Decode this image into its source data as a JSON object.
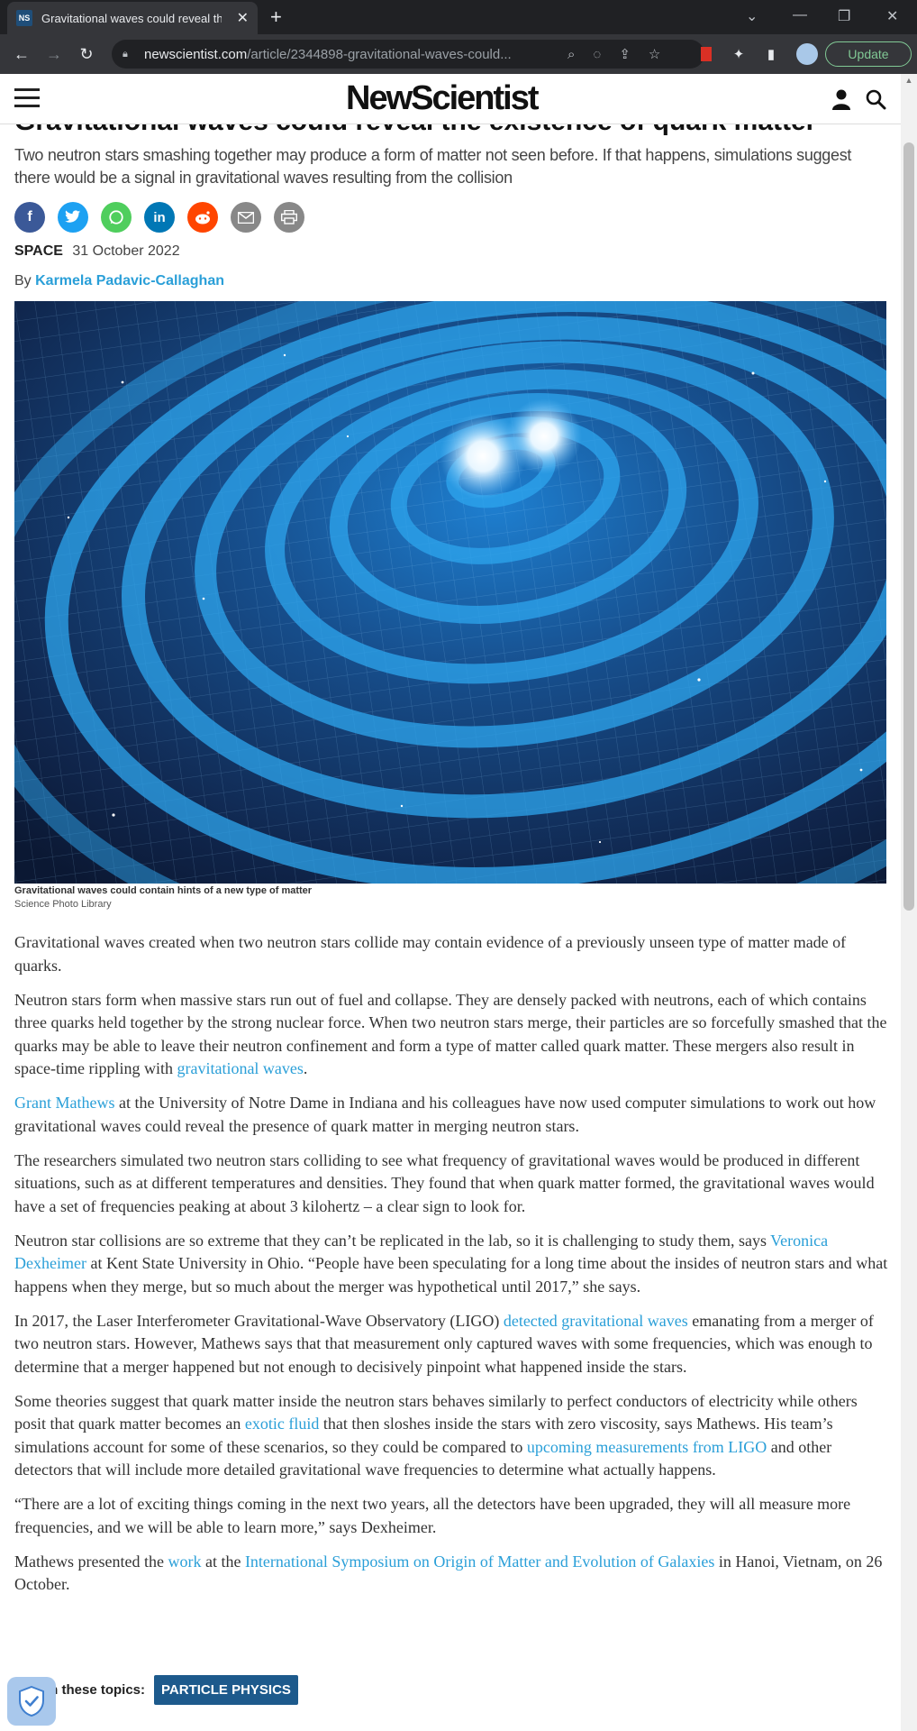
{
  "browser": {
    "tab_title": "Gravitational waves could reveal the existence of quark matter",
    "favicon_text": "NS",
    "url_domain": "newscientist.com",
    "url_path": "/article/2344898-gravitational-waves-could...",
    "update_label": "Update"
  },
  "site": {
    "logo": "NewScientist"
  },
  "article": {
    "title": "Gravitational waves could reveal the existence of quark matter",
    "standfirst": "Two neutron stars smashing together may produce a form of matter not seen before. If that happens, simulations suggest there would be a signal in gravitational waves resulting from the collision",
    "share_icons": [
      "facebook-icon",
      "twitter-icon",
      "whatsapp-icon",
      "linkedin-icon",
      "reddit-icon",
      "email-icon",
      "print-icon"
    ],
    "section": "SPACE",
    "date": "31 October 2022",
    "byline_prefix": "By",
    "author": "Karmela Padavic-Callaghan",
    "image_caption": "Gravitational waves could contain hints of a new type of matter",
    "image_credit": "Science Photo Library",
    "paragraphs": [
      {
        "t1": "Gravitational waves created when two neutron stars collide may contain evidence of a previously unseen type of matter made of quarks."
      },
      {
        "t1": "Neutron stars form when massive stars run out of fuel and collapse. They are densely packed with neutrons, each of which contains three quarks held together by the strong nuclear force. When two neutron stars merge, their particles are so forcefully smashed that the quarks may be able to leave their neutron confinement and form a type of matter called quark matter. These mergers also result in space-time rippling with ",
        "l1": "gravitational waves",
        "t2": "."
      },
      {
        "l1": "Grant Mathews",
        "t1": " at the University of Notre Dame in Indiana and his colleagues have now used computer simulations to work out how gravitational waves could reveal the presence of quark matter in merging neutron stars."
      },
      {
        "t1": "The researchers simulated two neutron stars colliding to see what frequency of gravitational waves would be produced in different situations, such as at different temperatures and densities. They found that when quark matter formed, the gravitational waves would have a set of frequencies peaking at about 3 kilohertz – a clear sign to look for."
      },
      {
        "t1": "Neutron star collisions are so extreme that they can’t be replicated in the lab, so it is challenging to study them, says ",
        "l1": "Veronica Dexheimer",
        "t2": " at Kent State University in Ohio. “People have been speculating for a long time about the insides of neutron stars and what happens when they merge, but so much about the merger was hypothetical until 2017,” she says."
      },
      {
        "t1": "In 2017, the Laser Interferometer Gravitational-Wave Observatory (LIGO) ",
        "l1": "detected gravitational waves",
        "t2": " emanating from a merger of two neutron stars. However, Mathews says that that measurement only captured waves with some frequencies, which was enough to determine that a merger happened but not enough to decisively pinpoint what happened inside the stars."
      },
      {
        "t1": "Some theories suggest that quark matter inside the neutron stars behaves similarly to perfect conductors of electricity while others posit that quark matter becomes an ",
        "l1": "exotic fluid",
        "t2": " that then sloshes inside the stars with zero viscosity, says Mathews. His team’s simulations account for some of these scenarios, so they could be compared to ",
        "l2": "upcoming measurements from LIGO",
        "t3": " and other detectors that will include more detailed gravitational wave frequencies to determine what actually happens."
      },
      {
        "t1": "“There are a lot of exciting things coming in the next two years, all the detectors have been upgraded, they will all measure more frequencies, and we will be able to learn more,” says Dexheimer."
      },
      {
        "t1": "Mathews presented the ",
        "l1": "work",
        "t2": " at the ",
        "l2": "International Symposium on Origin of Matter and Evolution of Galaxies",
        "t3": " in Hanoi, Vietnam, on 26 October."
      }
    ],
    "topics_label": "on these topics:",
    "topic": "PARTICLE PHYSICS"
  },
  "colors": {
    "link": "#2a9fd8",
    "topic_pill": "#1d5a8c",
    "update_green": "#81c995"
  }
}
